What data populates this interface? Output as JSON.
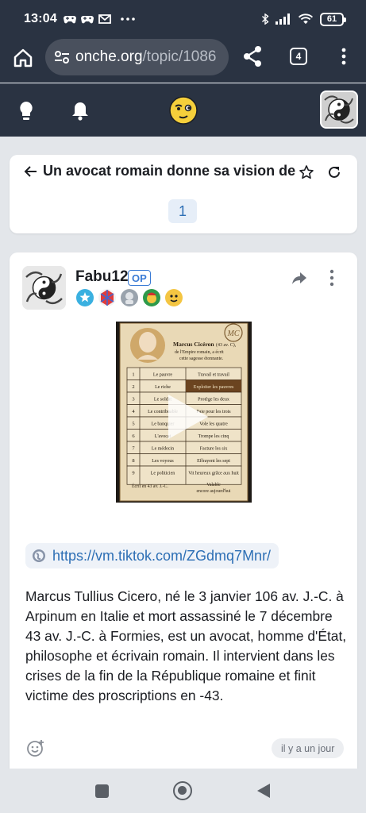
{
  "status_bar": {
    "time": "13:04",
    "battery": "61",
    "icons": [
      "game-controller-icon",
      "game-controller-icon",
      "gmail-icon",
      "more-dots-icon",
      "bluetooth-icon",
      "signal-icon",
      "wifi-icon",
      "battery-icon"
    ]
  },
  "browser": {
    "url_domain": "onche.org",
    "url_path": "/topic/1086",
    "tab_count": "4",
    "icons": [
      "home-icon",
      "site-info-icon",
      "share-icon",
      "tabs-icon",
      "kebab-menu-icon"
    ]
  },
  "site_header": {
    "icons": [
      "lightbulb-icon",
      "bell-icon",
      "site-logo-smiley",
      "user-avatar"
    ]
  },
  "topic": {
    "title": "Un avocat romain donne sa vision de la",
    "current_page": "1"
  },
  "post": {
    "author": "Fabu12",
    "op_label": "OP",
    "link": "https://vm.tiktok.com/ZGdmq7Mnr/",
    "body": "Marcus Tullius Cicero, né le 3 janvier 106 av. J.-C. à Arpinum en Italie et mort assassiné le 7 décembre 43 av. J.-C. à Formies, est un avocat, homme d'État, philosophe et écrivain romain. Il intervient dans les crises de la fin de la République romaine et finit victime des proscriptions en -43.",
    "timestamp": "il y a un jour",
    "video": {
      "heading": "Marcus Cicéron",
      "heading_dates": "(43 av. C),",
      "subtitle_1": "de l'Empire romain, a écrit",
      "subtitle_2": "cette sagesse étonnante.",
      "monogram": "MC",
      "rows": [
        {
          "n": "1",
          "who": "Le pauvre",
          "what": "Travail et travail"
        },
        {
          "n": "2",
          "who": "Le riche",
          "what": "Exploiter les pauvres"
        },
        {
          "n": "3",
          "who": "Le soldat",
          "what": "Protège les deux"
        },
        {
          "n": "4",
          "who": "Le contribuable",
          "what": "Paie pour les trois"
        },
        {
          "n": "5",
          "who": "Le banquier",
          "what": "Vole les quatre"
        },
        {
          "n": "6",
          "who": "L'avocat",
          "what": "Trompe les cinq"
        },
        {
          "n": "7",
          "who": "Le médecin",
          "what": "Facture les six"
        },
        {
          "n": "8",
          "who": "Les voyous",
          "what": "Effrayent les sept"
        },
        {
          "n": "9",
          "who": "Le politicien",
          "what": "Vit heureux grâce aux huit"
        }
      ],
      "footer_left": "Écrit en 43 av. J.-C.",
      "footer_right_1": "Valable",
      "footer_right_2": "encore aujourd'hui"
    }
  },
  "colors": {
    "header_bg": "#2a3342",
    "page_bg": "#e3e6ea",
    "link": "#2d6fb5",
    "accent": "#3a7bd5"
  }
}
